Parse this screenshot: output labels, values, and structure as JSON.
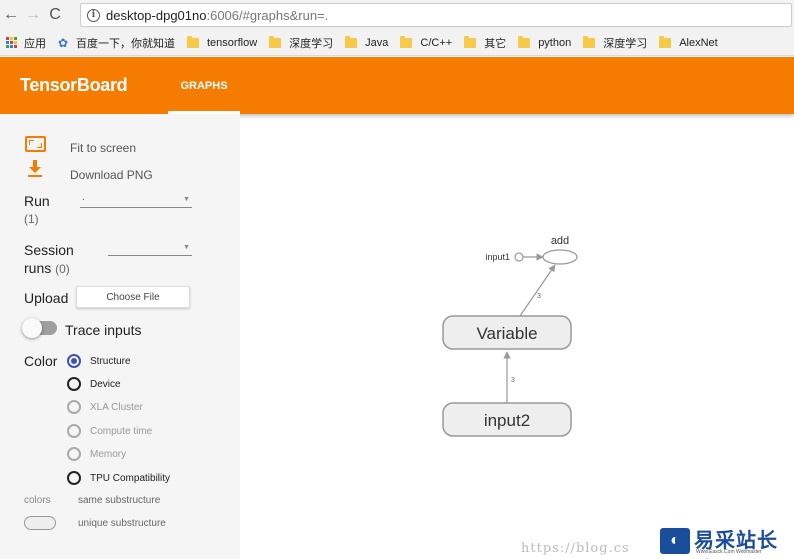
{
  "browser": {
    "url_host": "desktop-dpg01no",
    "url_rest": ":6006/#graphs&run=.",
    "nav": {
      "back": "←",
      "forward": "→",
      "reload": "C"
    },
    "info_icon": "i"
  },
  "bookmarks": [
    {
      "label": "应用",
      "icon": "apps-icon"
    },
    {
      "label": "百度一下，你就知道",
      "icon": "paw-icon"
    },
    {
      "label": "tensorflow",
      "icon": "folder-icon"
    },
    {
      "label": "深度学习",
      "icon": "folder-icon"
    },
    {
      "label": "Java",
      "icon": "folder-icon"
    },
    {
      "label": "C/C++",
      "icon": "folder-icon"
    },
    {
      "label": "其它",
      "icon": "folder-icon"
    },
    {
      "label": "python",
      "icon": "folder-icon"
    },
    {
      "label": "深度学习",
      "icon": "folder-icon"
    },
    {
      "label": "AlexNet",
      "icon": "folder-icon"
    }
  ],
  "header": {
    "title": "TensorBoard",
    "tab": "GRAPHS",
    "color": "#f57c00"
  },
  "sidebar": {
    "fit_label": "Fit to screen",
    "download_label": "Download PNG",
    "run_label": "Run",
    "run_count": "(1)",
    "run_value": ".",
    "session_label": "Session",
    "session_runs": "runs",
    "session_count": "(0)",
    "upload_label": "Upload",
    "choose_file": "Choose File",
    "trace_inputs": "Trace inputs",
    "color_label": "Color",
    "color_options": [
      {
        "label": "Structure",
        "checked": true,
        "disabled": false
      },
      {
        "label": "Device",
        "checked": false,
        "disabled": false
      },
      {
        "label": "XLA Cluster",
        "checked": false,
        "disabled": true
      },
      {
        "label": "Compute time",
        "checked": false,
        "disabled": true
      },
      {
        "label": "Memory",
        "checked": false,
        "disabled": true
      },
      {
        "label": "TPU Compatibility",
        "checked": false,
        "disabled": false
      }
    ],
    "legend_title": "colors",
    "legend_same": "same substructure",
    "legend_unique": "unique substructure"
  },
  "graph": {
    "nodes": {
      "add": "add",
      "input1": "input1",
      "variable": "Variable",
      "input2": "input2"
    },
    "edge_labels": {
      "variable_to_add": "3",
      "input2_to_variable": "3"
    }
  },
  "watermark": {
    "url": "https://blog.cs",
    "logo_glyph": "◐",
    "name": "易采站长站",
    "sub": "Www.Easck.Com Webmaster"
  }
}
